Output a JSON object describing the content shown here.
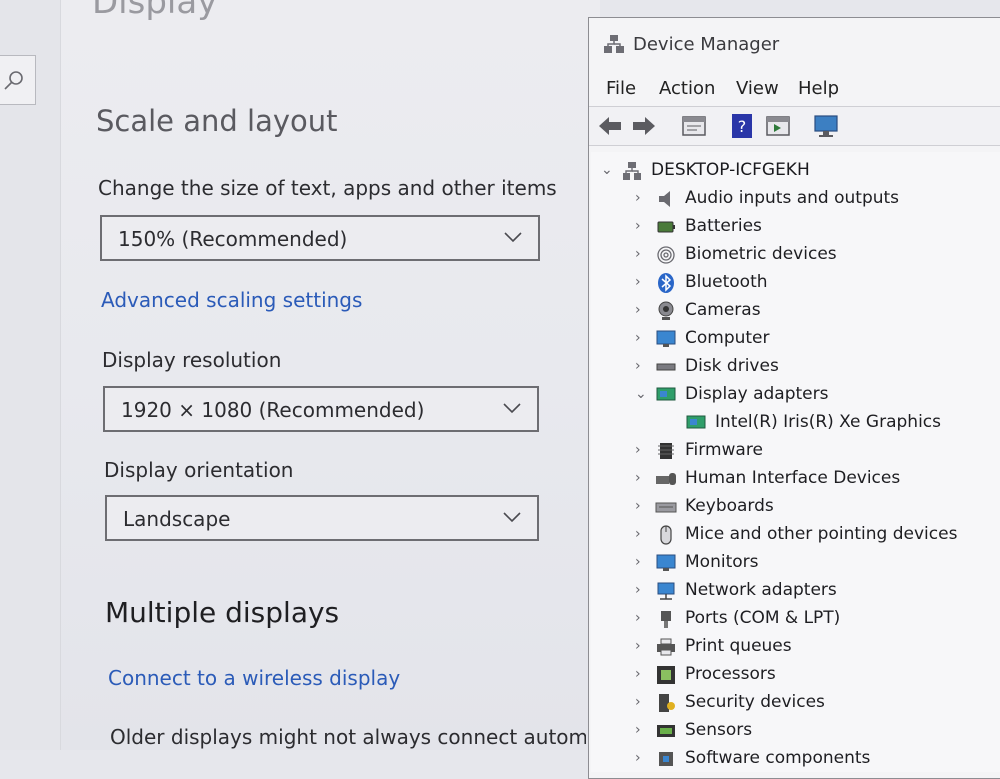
{
  "settings": {
    "page_title": "Display",
    "scale_section_title": "Scale and layout",
    "scale_label": "Change the size of text, apps and other items",
    "scale_value": "150% (Recommended)",
    "advanced_link": "Advanced scaling settings",
    "resolution_label": "Display resolution",
    "resolution_value": "1920 × 1080 (Recommended)",
    "orientation_label": "Display orientation",
    "orientation_value": "Landscape",
    "multiple_title": "Multiple displays",
    "wireless_link": "Connect to a wireless display",
    "older_text": "Older displays might not always connect automati"
  },
  "devmgr": {
    "title": "Device Manager",
    "menu": [
      "File",
      "Action",
      "View",
      "Help"
    ],
    "root": "DESKTOP-ICFGEKH",
    "items": [
      {
        "label": "Audio inputs and outputs",
        "icon": "speaker-icon",
        "expanded": false
      },
      {
        "label": "Batteries",
        "icon": "battery-icon",
        "expanded": false
      },
      {
        "label": "Biometric devices",
        "icon": "fingerprint-icon",
        "expanded": false
      },
      {
        "label": "Bluetooth",
        "icon": "bluetooth-icon",
        "expanded": false
      },
      {
        "label": "Cameras",
        "icon": "camera-icon",
        "expanded": false
      },
      {
        "label": "Computer",
        "icon": "computer-icon",
        "expanded": false
      },
      {
        "label": "Disk drives",
        "icon": "disk-icon",
        "expanded": false
      },
      {
        "label": "Display adapters",
        "icon": "display-adapter-icon",
        "expanded": true
      },
      {
        "label": "Intel(R) Iris(R) Xe Graphics",
        "icon": "display-adapter-icon",
        "child": true
      },
      {
        "label": "Firmware",
        "icon": "chip-icon",
        "expanded": false
      },
      {
        "label": "Human Interface Devices",
        "icon": "hid-icon",
        "expanded": false
      },
      {
        "label": "Keyboards",
        "icon": "keyboard-icon",
        "expanded": false
      },
      {
        "label": "Mice and other pointing devices",
        "icon": "mouse-icon",
        "expanded": false
      },
      {
        "label": "Monitors",
        "icon": "monitor-icon",
        "expanded": false
      },
      {
        "label": "Network adapters",
        "icon": "network-icon",
        "expanded": false
      },
      {
        "label": "Ports (COM & LPT)",
        "icon": "port-icon",
        "expanded": false
      },
      {
        "label": "Print queues",
        "icon": "printer-icon",
        "expanded": false
      },
      {
        "label": "Processors",
        "icon": "processor-icon",
        "expanded": false
      },
      {
        "label": "Security devices",
        "icon": "security-icon",
        "expanded": false
      },
      {
        "label": "Sensors",
        "icon": "sensor-icon",
        "expanded": false
      },
      {
        "label": "Software components",
        "icon": "software-icon",
        "expanded": false
      }
    ]
  }
}
